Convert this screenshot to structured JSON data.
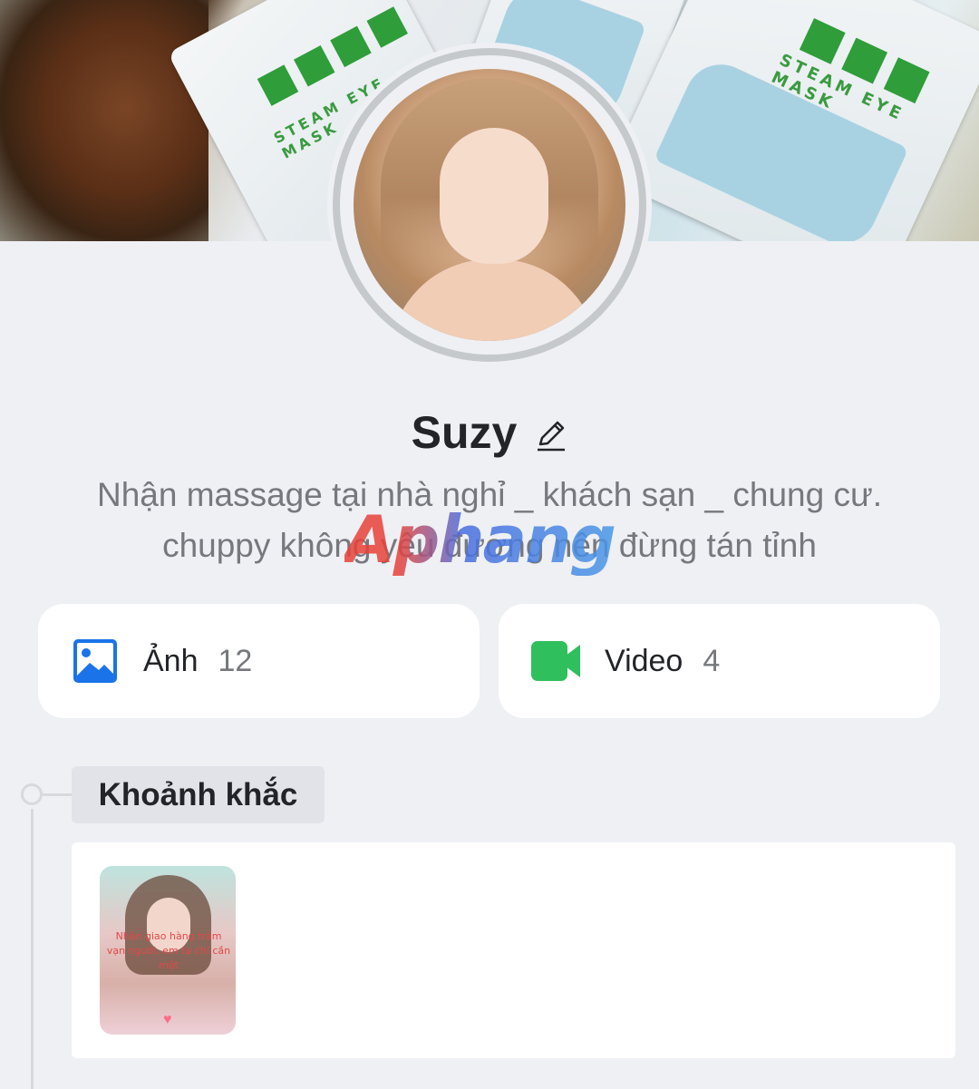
{
  "profile": {
    "name": "Suzy",
    "bio_line1": "Nhận massage tại nhà nghỉ _ khách sạn _ chung cư.",
    "bio_line2": "chuppy không yêu đương nên đừng tán tỉnh"
  },
  "cover": {
    "pack_text": "STEAM EYE MASK"
  },
  "watermark": "Aphang",
  "stats": {
    "photos": {
      "label": "Ảnh",
      "count": "12",
      "icon": "image-icon",
      "color": "#1a73e8"
    },
    "videos": {
      "label": "Video",
      "count": "4",
      "icon": "video-camera-icon",
      "color": "#2fbf5c"
    }
  },
  "moments": {
    "title": "Khoảnh khắc",
    "items": [
      {
        "caption": "Nhận giao hàng trăm vạn người, em ta chỉ cần một"
      }
    ]
  }
}
